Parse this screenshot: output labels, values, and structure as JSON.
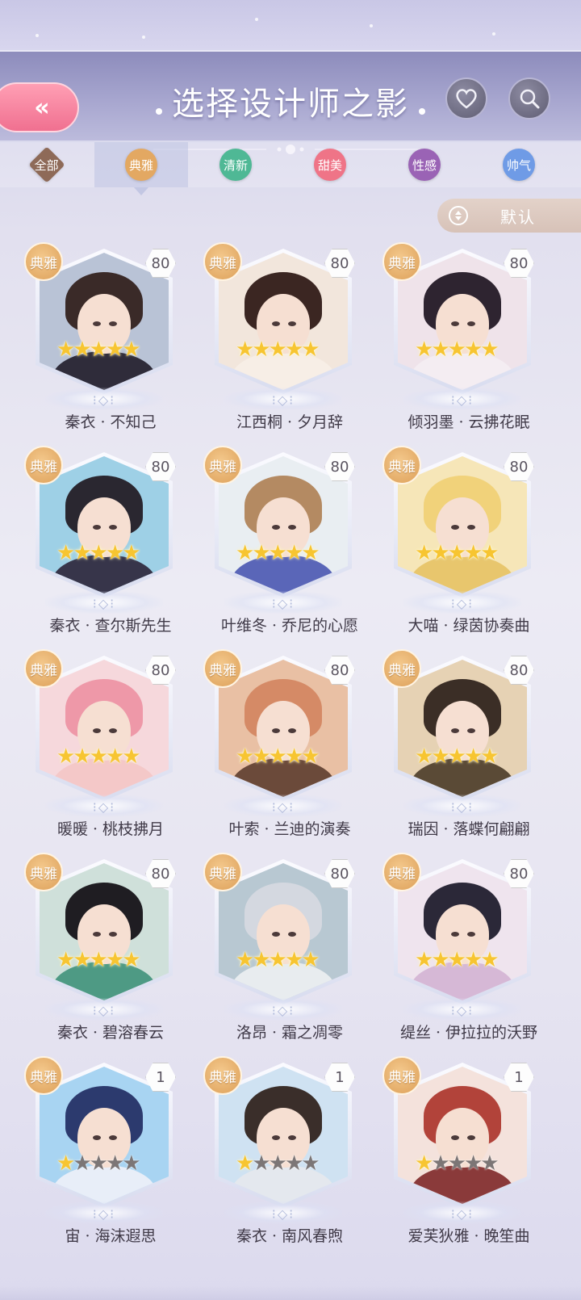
{
  "header": {
    "title": "选择设计师之影",
    "back_glyph": "«",
    "favorite_icon": "heart-icon",
    "search_icon": "search-icon"
  },
  "tabs": [
    {
      "label": "全部",
      "color": "#8e6a58",
      "shape": "diamond",
      "active": false
    },
    {
      "label": "典雅",
      "color": "#e3a862",
      "shape": "circle",
      "active": true
    },
    {
      "label": "清新",
      "color": "#4fb895",
      "shape": "circle",
      "active": false
    },
    {
      "label": "甜美",
      "color": "#ef7487",
      "shape": "circle",
      "active": false
    },
    {
      "label": "性感",
      "color": "#9a63b5",
      "shape": "circle",
      "active": false
    },
    {
      "label": "帅气",
      "color": "#6f9be6",
      "shape": "circle",
      "active": false
    }
  ],
  "sort": {
    "label": "默认",
    "icon": "sort-icon"
  },
  "cards": [
    {
      "name": "秦衣 · 不知己",
      "style": "典雅",
      "level": "80",
      "stars": 5,
      "max_stars": 5
    },
    {
      "name": "江西桐 · 夕月辞",
      "style": "典雅",
      "level": "80",
      "stars": 5,
      "max_stars": 5
    },
    {
      "name": "倾羽墨 · 云拂花眠",
      "style": "典雅",
      "level": "80",
      "stars": 5,
      "max_stars": 5
    },
    {
      "name": "秦衣 · 查尔斯先生",
      "style": "典雅",
      "level": "80",
      "stars": 5,
      "max_stars": 5
    },
    {
      "name": "叶维冬 · 乔尼的心愿",
      "style": "典雅",
      "level": "80",
      "stars": 5,
      "max_stars": 5
    },
    {
      "name": "大喵 · 绿茵协奏曲",
      "style": "典雅",
      "level": "80",
      "stars": 5,
      "max_stars": 5
    },
    {
      "name": "暖暖 · 桃枝拂月",
      "style": "典雅",
      "level": "80",
      "stars": 5,
      "max_stars": 5
    },
    {
      "name": "叶索 · 兰迪的演奏",
      "style": "典雅",
      "level": "80",
      "stars": 5,
      "max_stars": 5
    },
    {
      "name": "瑞因 · 落蝶何翩翩",
      "style": "典雅",
      "level": "80",
      "stars": 5,
      "max_stars": 5
    },
    {
      "name": "秦衣 · 碧溶春云",
      "style": "典雅",
      "level": "80",
      "stars": 5,
      "max_stars": 5
    },
    {
      "name": "洛昂 · 霜之凋零",
      "style": "典雅",
      "level": "80",
      "stars": 5,
      "max_stars": 5
    },
    {
      "name": "缇丝 · 伊拉拉的沃野",
      "style": "典雅",
      "level": "80",
      "stars": 5,
      "max_stars": 5
    },
    {
      "name": "宙 · 海沫遐思",
      "style": "典雅",
      "level": "1",
      "stars": 1,
      "max_stars": 5
    },
    {
      "name": "秦衣 · 南风春煦",
      "style": "典雅",
      "level": "1",
      "stars": 1,
      "max_stars": 5
    },
    {
      "name": "爱芙狄雅 · 晚笙曲",
      "style": "典雅",
      "level": "1",
      "stars": 1,
      "max_stars": 5
    }
  ],
  "palette": {
    "portrait_themes": [
      {
        "bg": "#b9c3d6",
        "hair": "#3a2a28",
        "body": "#2f2c3a"
      },
      {
        "bg": "#f2e6dc",
        "hair": "#3b2622",
        "body": "#f7eee6"
      },
      {
        "bg": "#efe3ea",
        "hair": "#2e2430",
        "body": "#f4edf2"
      },
      {
        "bg": "#9ed0e6",
        "hair": "#2a2730",
        "body": "#37354a"
      },
      {
        "bg": "#e9eef2",
        "hair": "#b48a62",
        "body": "#5a66b8"
      },
      {
        "bg": "#f6e6b8",
        "hair": "#f1d27a",
        "body": "#e8c66d"
      },
      {
        "bg": "#f6d8dc",
        "hair": "#ee98a8",
        "body": "#f4c8c8"
      },
      {
        "bg": "#e9c0a4",
        "hair": "#d58a66",
        "body": "#6b4a3a"
      },
      {
        "bg": "#e6d2b4",
        "hair": "#3b2e26",
        "body": "#5a4a36"
      },
      {
        "bg": "#cfe0da",
        "hair": "#1f1d22",
        "body": "#4e9a84"
      },
      {
        "bg": "#b8c8d2",
        "hair": "#d4d8e0",
        "body": "#e8ecef"
      },
      {
        "bg": "#efe4ee",
        "hair": "#2b2838",
        "body": "#d6b8d6"
      },
      {
        "bg": "#a8d4f2",
        "hair": "#2c3a6e",
        "body": "#e8eef8"
      },
      {
        "bg": "#cfe2f2",
        "hair": "#3a2e2a",
        "body": "#e4e8ee"
      },
      {
        "bg": "#f4e2dc",
        "hair": "#b2433a",
        "body": "#8a3a3a"
      }
    ]
  }
}
